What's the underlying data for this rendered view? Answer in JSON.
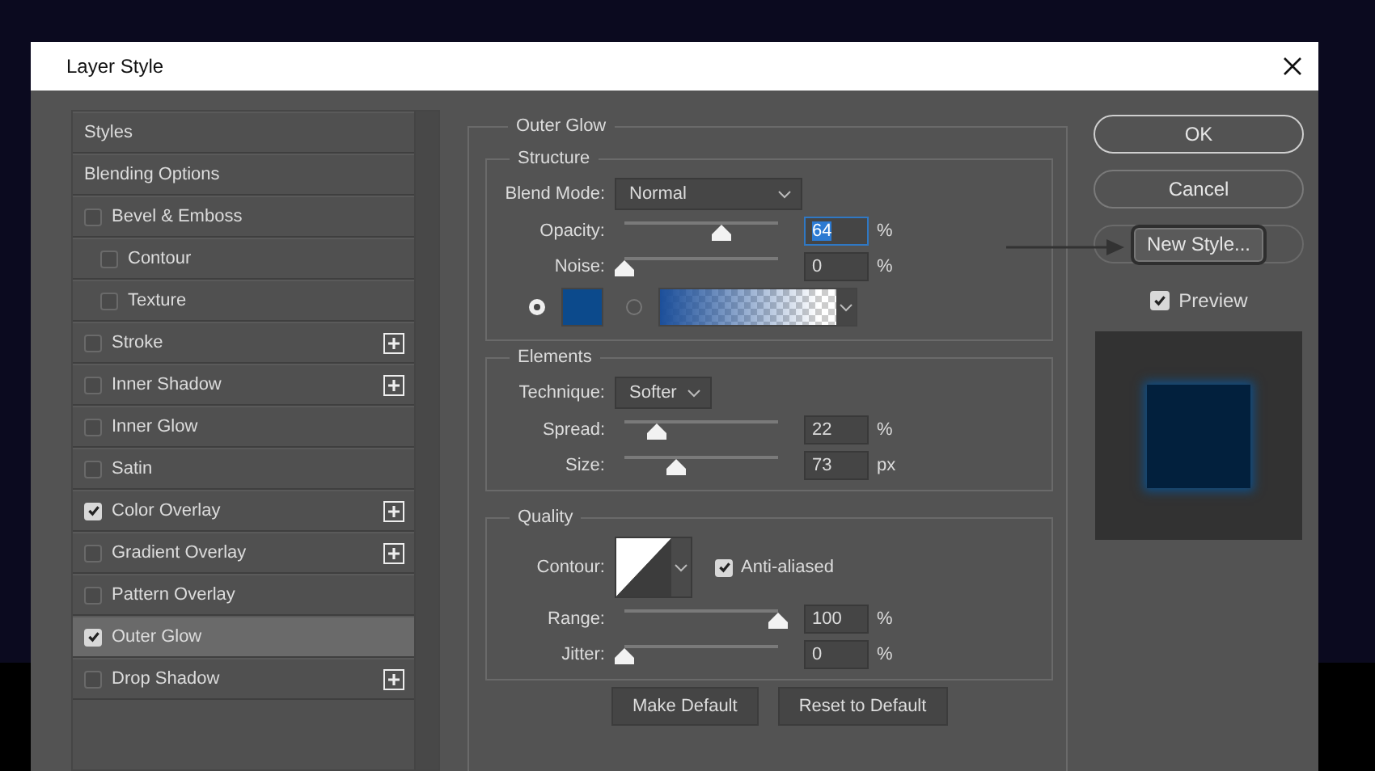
{
  "window": {
    "title": "Layer Style"
  },
  "styles_list": {
    "items": [
      {
        "label": "Styles",
        "kind": "header",
        "selected": false
      },
      {
        "label": "Blending Options",
        "kind": "header",
        "selected": false
      },
      {
        "label": "Bevel & Emboss",
        "kind": "effect",
        "checked": false,
        "has_add": false,
        "selected": false,
        "children": [
          {
            "label": "Contour",
            "kind": "effect",
            "checked": false,
            "has_add": false,
            "selected": false
          },
          {
            "label": "Texture",
            "kind": "effect",
            "checked": false,
            "has_add": false,
            "selected": false
          }
        ]
      },
      {
        "label": "Stroke",
        "kind": "effect",
        "checked": false,
        "has_add": true,
        "selected": false
      },
      {
        "label": "Inner Shadow",
        "kind": "effect",
        "checked": false,
        "has_add": true,
        "selected": false
      },
      {
        "label": "Inner Glow",
        "kind": "effect",
        "checked": false,
        "has_add": false,
        "selected": false
      },
      {
        "label": "Satin",
        "kind": "effect",
        "checked": false,
        "has_add": false,
        "selected": false
      },
      {
        "label": "Color Overlay",
        "kind": "effect",
        "checked": true,
        "has_add": true,
        "selected": false
      },
      {
        "label": "Gradient Overlay",
        "kind": "effect",
        "checked": false,
        "has_add": true,
        "selected": false
      },
      {
        "label": "Pattern Overlay",
        "kind": "effect",
        "checked": false,
        "has_add": false,
        "selected": false
      },
      {
        "label": "Outer Glow",
        "kind": "effect",
        "checked": true,
        "has_add": false,
        "selected": true
      },
      {
        "label": "Drop Shadow",
        "kind": "effect",
        "checked": false,
        "has_add": true,
        "selected": false
      }
    ]
  },
  "panel": {
    "title": "Outer Glow",
    "structure": {
      "title": "Structure",
      "blend_mode": {
        "label": "Blend Mode:",
        "value": "Normal"
      },
      "sliders": [
        {
          "label": "Opacity:",
          "level": 0.63,
          "value": "64",
          "unit": "%",
          "focused": true
        },
        {
          "label": "Noise:",
          "level": 0,
          "value": "0",
          "unit": "%",
          "focused": false
        }
      ],
      "fill_options": [
        {
          "kind": "color",
          "selected": true,
          "color": "#0c4a8c"
        },
        {
          "kind": "gradient",
          "selected": false,
          "color": "#1c4f9a"
        }
      ]
    },
    "elements": {
      "title": "Elements",
      "technique": {
        "label": "Technique:",
        "value": "Softer"
      },
      "sliders": [
        {
          "label": "Spread:",
          "level": 0.21,
          "value": "22",
          "unit": "%",
          "focused": false
        },
        {
          "label": "Size:",
          "level": 0.34,
          "value": "73",
          "unit": "px",
          "focused": false
        }
      ]
    },
    "quality": {
      "title": "Quality",
      "contour": {
        "label": "Contour:"
      },
      "anti_aliased": {
        "label": "Anti-aliased",
        "checked": true
      },
      "sliders": [
        {
          "label": "Range:",
          "level": 1,
          "value": "100",
          "unit": "%",
          "focused": false
        },
        {
          "label": "Jitter:",
          "level": 0,
          "value": "0",
          "unit": "%",
          "focused": false
        }
      ]
    },
    "buttons": [
      "Make Default",
      "Reset to Default"
    ]
  },
  "actions": {
    "buttons": [
      {
        "label": "OK",
        "highlighted": false
      },
      {
        "label": "Cancel",
        "highlighted": false
      },
      {
        "label": "New Style...",
        "highlighted": true
      }
    ],
    "preview": {
      "label": "Preview",
      "checked": true
    }
  }
}
